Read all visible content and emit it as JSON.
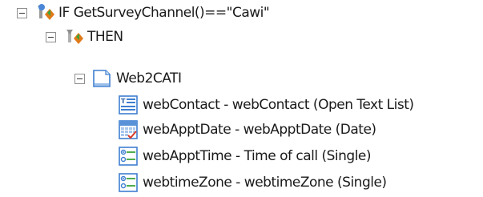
{
  "tree": {
    "if_node": {
      "label": "IF GetSurveyChannel()==\"Cawi\"",
      "icon": "condition-if-icon"
    },
    "then_node": {
      "label": "THEN",
      "icon": "condition-then-icon"
    },
    "block_node": {
      "label": "Web2CATI",
      "icon": "block-page-icon"
    },
    "questions": [
      {
        "label": "webContact - webContact (Open Text List)",
        "icon": "open-text-list-icon"
      },
      {
        "label": "webApptDate - webApptDate (Date)",
        "icon": "date-question-icon"
      },
      {
        "label": "webApptTime - Time of call (Single)",
        "icon": "single-choice-icon"
      },
      {
        "label": "webtimeZone - webtimeZone (Single)",
        "icon": "single-choice-icon"
      }
    ]
  },
  "colors": {
    "accent_green": "#3aa53a",
    "accent_orange": "#e07a1a",
    "icon_blue": "#3f7fd0"
  }
}
